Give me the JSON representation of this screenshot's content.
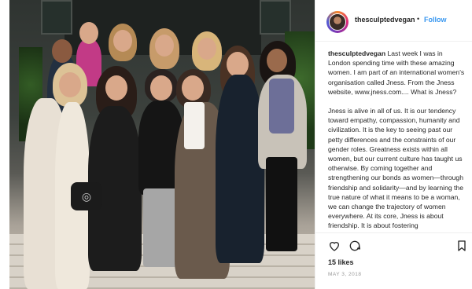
{
  "header": {
    "username": "thesculptedvegan",
    "separator": "•",
    "follow_label": "Follow"
  },
  "caption": {
    "username": "thesculptedvegan",
    "paragraph1": "Last week I was in London spending time with these amazing women. I am part of an international women's organisation called Jness. From the Jness website, www.jness.com.... What is Jness?",
    "paragraph2": "Jness is alive in all of us. It is our tendency toward empathy, compassion, humanity and civilization. It is the key to seeing past our petty differences and the constraints of our gender roles. Greatness exists within all women, but our current culture has taught us otherwise. By coming together and strengthening our bonds as women—through friendship and solidarity—and by learning the true nature of what it means to be a woman, we can change the trajectory of women everywhere. At its core, Jness is about friendship. It is about fostering"
  },
  "actions": {
    "like_icon": "heart-icon",
    "comment_icon": "comment-icon",
    "save_icon": "bookmark-icon"
  },
  "likes": "15 likes",
  "date": "MAY 3, 2018",
  "colors": {
    "accent": "#3897f0",
    "text": "#262626",
    "muted": "#999999"
  }
}
